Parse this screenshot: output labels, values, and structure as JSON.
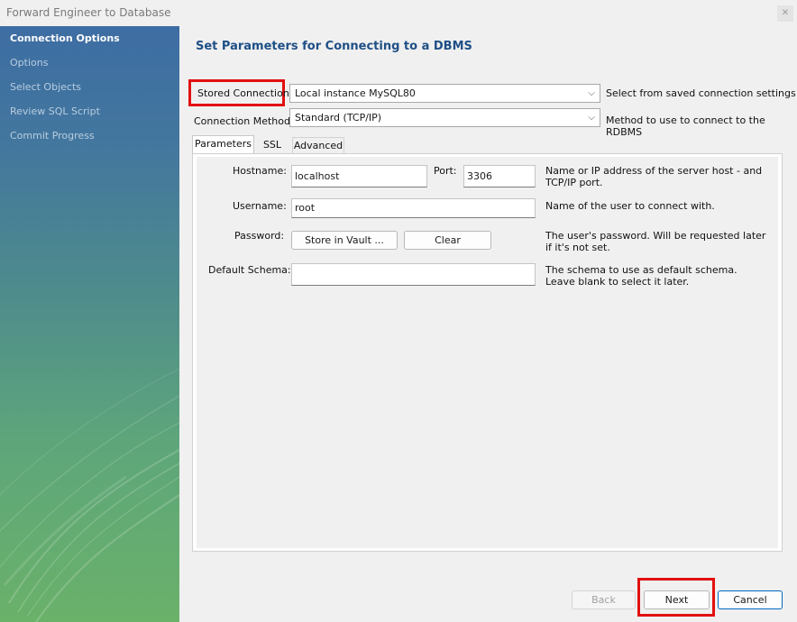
{
  "window": {
    "title": "Forward Engineer to Database"
  },
  "sidebar": {
    "items": [
      {
        "label": "Connection Options",
        "active": true
      },
      {
        "label": "Options"
      },
      {
        "label": "Select Objects"
      },
      {
        "label": "Review SQL Script"
      },
      {
        "label": "Commit Progress"
      }
    ]
  },
  "main": {
    "heading": "Set Parameters for Connecting to a DBMS",
    "stored_connection": {
      "label": "Stored Connection:",
      "value": "Local instance MySQL80",
      "hint": "Select from saved connection settings"
    },
    "connection_method": {
      "label": "Connection Method:",
      "value": "Standard (TCP/IP)",
      "hint": "Method to use to connect to the RDBMS"
    },
    "tabs": [
      {
        "label": "Parameters",
        "active": true
      },
      {
        "label": "SSL"
      },
      {
        "label": "Advanced"
      }
    ],
    "parameters": {
      "hostname": {
        "label": "Hostname:",
        "value": "localhost"
      },
      "port": {
        "label": "Port:",
        "value": "3306"
      },
      "host_hint": "Name or IP address of the server host - and TCP/IP port.",
      "username": {
        "label": "Username:",
        "value": "root",
        "hint": "Name of the user to connect with."
      },
      "password": {
        "label": "Password:",
        "store_button": "Store in Vault ...",
        "clear_button": "Clear",
        "hint": "The user's password. Will be requested later if it's not set."
      },
      "default_schema": {
        "label": "Default Schema:",
        "value": "",
        "hint": "The schema to use as default schema. Leave blank to select it later."
      }
    }
  },
  "footer": {
    "back": "Back",
    "next": "Next",
    "cancel": "Cancel"
  },
  "colors": {
    "highlight": "#e21010",
    "heading": "#1f4f86",
    "sidebar_top": "#3d6da3",
    "sidebar_bottom": "#6ab16a"
  },
  "icons": {
    "dropdown": "chevron-down-icon",
    "close": "close-icon"
  }
}
